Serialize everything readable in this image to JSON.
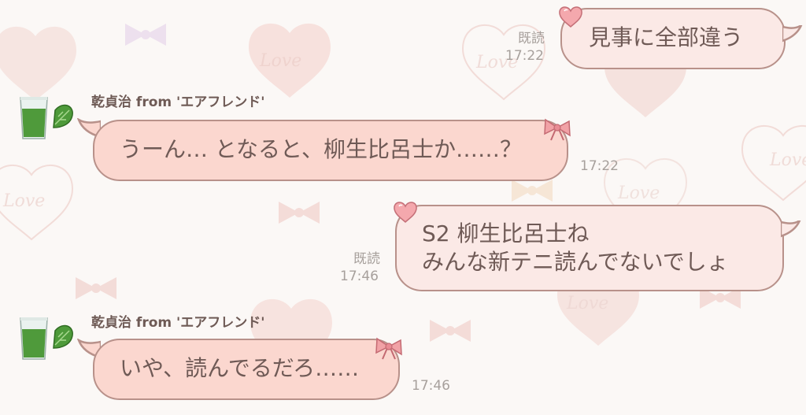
{
  "messages": [
    {
      "direction": "out",
      "text": [
        "見事に全部違う"
      ],
      "read": "既読",
      "time": "17:22"
    },
    {
      "direction": "in",
      "sender": "乾貞治 from 'エアフレンド'",
      "text": [
        "うーん… となると、柳生比呂士か……？"
      ],
      "time": "17:22"
    },
    {
      "direction": "out",
      "text": [
        "S2 柳生比呂士ね",
        "みんな新テニ読んでないでしょ"
      ],
      "read": "既読",
      "time": "17:46"
    },
    {
      "direction": "in",
      "sender": "乾貞治 from 'エアフレンド'",
      "text": [
        "いや、読んでるだろ……"
      ],
      "time": "17:46"
    }
  ],
  "background_text": "Love",
  "colors": {
    "background": "#fbf8f6",
    "incoming_bubble": "#fbd7cf",
    "outgoing_bubble": "#fbe9e6",
    "bubble_border": "#b8918a",
    "bubble_text": "#6f5a56",
    "meta_text": "#a7a09c",
    "sender_text": "#6e5a55"
  },
  "icons": {
    "avatar": "green-juice-glass-with-leaf-icon",
    "incoming_decoration": "pink-bow-icon",
    "outgoing_decoration": "heart-icon"
  }
}
